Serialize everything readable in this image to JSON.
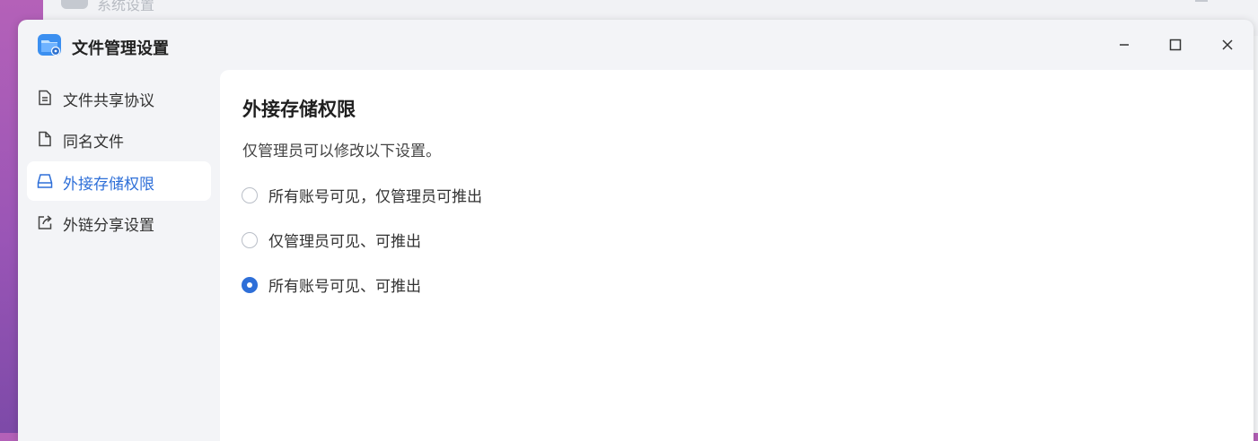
{
  "background_window": {
    "title": "系统设置"
  },
  "window": {
    "title": "文件管理设置",
    "controls": {
      "minimize_icon": "minimize-icon",
      "maximize_icon": "maximize-icon",
      "close_icon": "close-icon"
    }
  },
  "sidebar": {
    "items": [
      {
        "label": "文件共享协议",
        "icon": "document-icon",
        "active": false
      },
      {
        "label": "同名文件",
        "icon": "file-icon",
        "active": false
      },
      {
        "label": "外接存储权限",
        "icon": "drive-icon",
        "active": true
      },
      {
        "label": "外链分享设置",
        "icon": "share-icon",
        "active": false
      }
    ]
  },
  "content": {
    "title": "外接存储权限",
    "description": "仅管理员可以修改以下设置。",
    "options": [
      {
        "label": "所有账号可见，仅管理员可推出",
        "checked": false
      },
      {
        "label": "仅管理员可见、可推出",
        "checked": false
      },
      {
        "label": "所有账号可见、可推出",
        "checked": true
      }
    ]
  },
  "colors": {
    "accent": "#2e6fd8",
    "window_bg": "#f3f4f7",
    "content_bg": "#ffffff"
  }
}
